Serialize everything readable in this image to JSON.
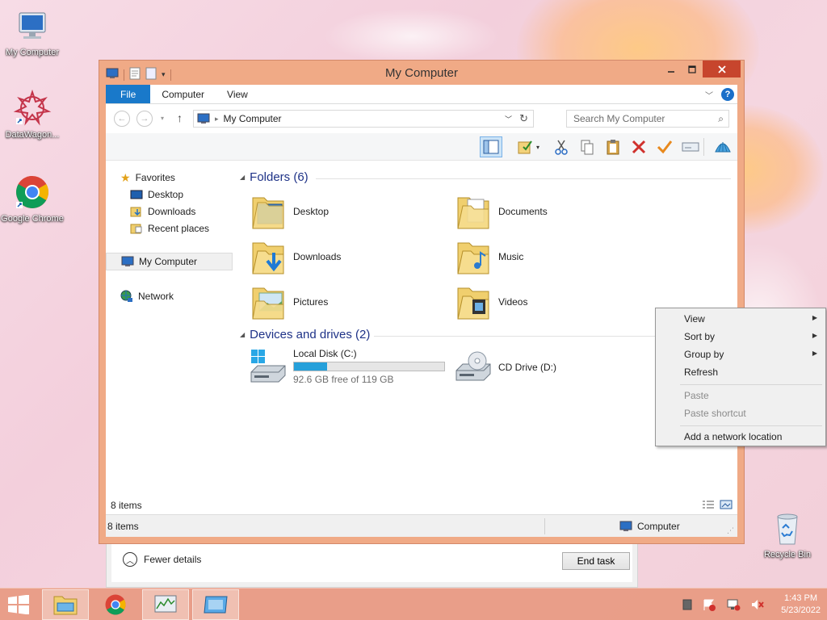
{
  "desktop": {
    "icons": [
      {
        "label": "My Computer",
        "icon": "my-computer-icon"
      },
      {
        "label": "DataWagon...",
        "icon": "datawagon-icon"
      },
      {
        "label": "Google Chrome",
        "icon": "chrome-icon"
      },
      {
        "label": "Recycle Bin",
        "icon": "recycle-bin-icon"
      }
    ]
  },
  "taskmgr": {
    "fewer_details": "Fewer details",
    "end_task": "End task"
  },
  "window": {
    "title": "My Computer",
    "tabs": [
      "File",
      "Computer",
      "View"
    ],
    "address": {
      "path": "My Computer"
    },
    "search": {
      "placeholder": "Search My Computer"
    }
  },
  "nav": {
    "favorites": "Favorites",
    "items": [
      "Desktop",
      "Downloads",
      "Recent places"
    ],
    "computer": "My Computer",
    "network": "Network"
  },
  "content": {
    "folders_header": "Folders (6)",
    "folders": [
      {
        "name": "Desktop",
        "overlay": "desktop"
      },
      {
        "name": "Documents",
        "overlay": "documents"
      },
      {
        "name": "Downloads",
        "overlay": "downloads"
      },
      {
        "name": "Music",
        "overlay": "music"
      },
      {
        "name": "Pictures",
        "overlay": "pictures"
      },
      {
        "name": "Videos",
        "overlay": "videos"
      }
    ],
    "devices_header": "Devices and drives (2)",
    "drives": [
      {
        "name": "Local Disk (C:)",
        "free": "92.6 GB free of 119 GB",
        "used_fraction": 0.22
      },
      {
        "name": "CD Drive (D:)"
      }
    ]
  },
  "status": {
    "inner_count": "8 items",
    "count": "8 items",
    "zone": "Computer"
  },
  "context_menu": {
    "items": [
      {
        "label": "View",
        "submenu": true,
        "disabled": false
      },
      {
        "label": "Sort by",
        "submenu": true,
        "disabled": false
      },
      {
        "label": "Group by",
        "submenu": true,
        "disabled": false
      },
      {
        "label": "Refresh",
        "submenu": false,
        "disabled": false
      },
      {
        "label": "Paste",
        "submenu": false,
        "disabled": true
      },
      {
        "label": "Paste shortcut",
        "submenu": false,
        "disabled": true
      },
      {
        "label": "Add a network location",
        "submenu": false,
        "disabled": false
      }
    ]
  },
  "taskbar": {
    "time": "1:43 PM",
    "date": "5/23/2022"
  },
  "colors": {
    "accent": "#1979ca",
    "window_frame": "#f0aa86",
    "close": "#c7452d",
    "drive_fill": "#26a0da"
  }
}
